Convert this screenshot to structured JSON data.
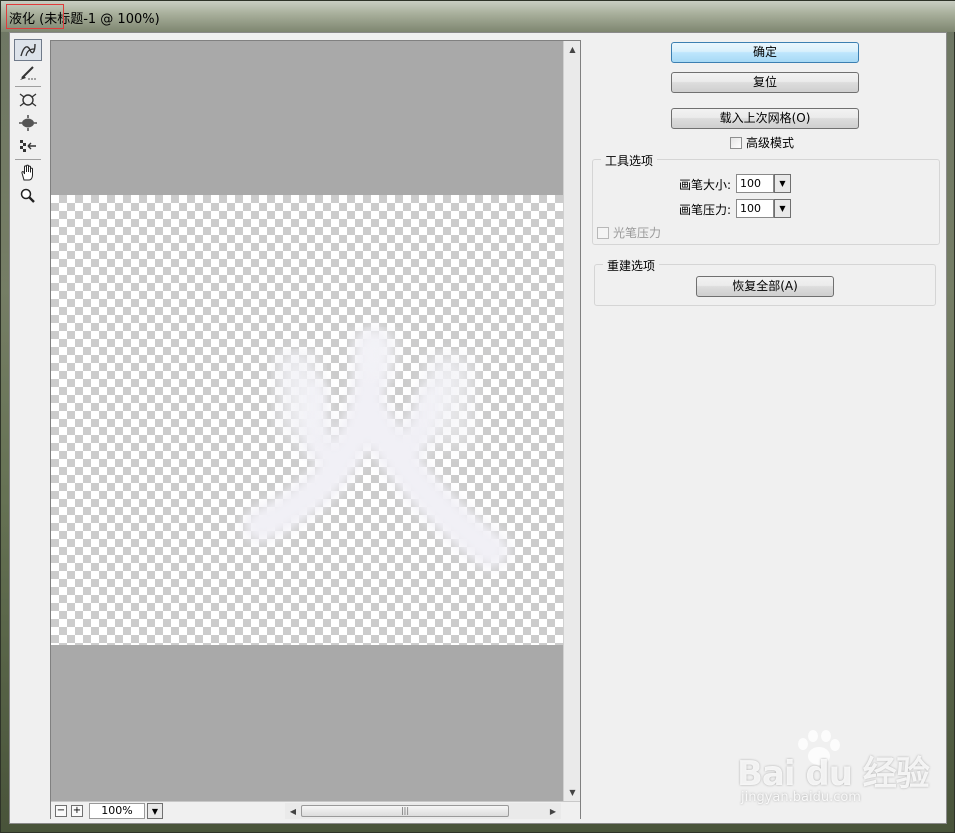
{
  "window": {
    "title": "液化 (未标题-1 @ 100%)"
  },
  "tools": [
    {
      "icon": "forward-warp-icon",
      "active": true
    },
    {
      "icon": "reconstruct-icon"
    },
    {
      "icon": "pucker-icon"
    },
    {
      "icon": "bloat-icon"
    },
    {
      "icon": "push-left-icon"
    },
    {
      "icon": "hand-icon"
    },
    {
      "icon": "zoom-icon"
    }
  ],
  "canvas": {
    "zoom_value": "100%",
    "zoom_minus": "−",
    "zoom_plus": "+"
  },
  "buttons": {
    "ok": "确定",
    "reset": "复位",
    "load_mesh": "载入上次网格(O)",
    "restore_all": "恢复全部(A)"
  },
  "advanced_mode": {
    "label": "高级模式",
    "checked": false
  },
  "tool_options": {
    "title": "工具选项",
    "brush_size_label": "画笔大小:",
    "brush_size_value": "100",
    "brush_pressure_label": "画笔压力:",
    "brush_pressure_value": "100",
    "stylus_pressure_label": "光笔压力",
    "stylus_pressure_checked": false
  },
  "reconstruct_options": {
    "title": "重建选项"
  },
  "watermark": {
    "brand": "Bai du 经验",
    "url": "jingyan.baidu.com"
  },
  "colors": {
    "primary_button": "#bee6fd",
    "canvas_background": "#a9a9a9",
    "panel_background": "#f0f0f0"
  }
}
